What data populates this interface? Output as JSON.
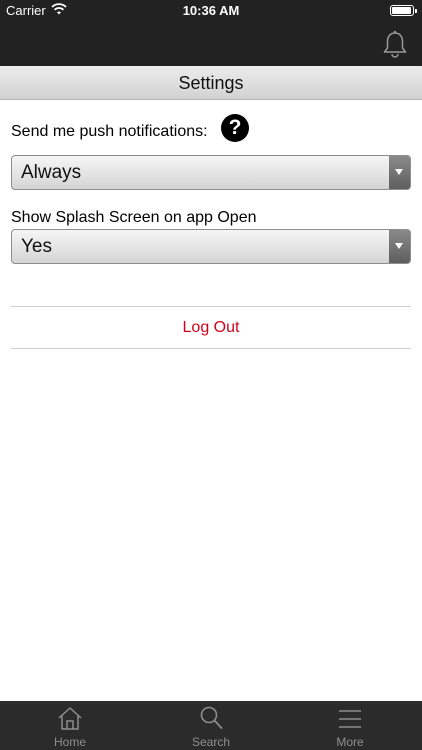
{
  "status_bar": {
    "carrier": "Carrier",
    "time": "10:36 AM",
    "battery_level": 0.95
  },
  "nav_bar": {
    "icon": "bell-icon"
  },
  "title": "Settings",
  "settings": {
    "push_label": "Send me push notifications:",
    "push_value": "Always",
    "help_icon": "question-circle-icon",
    "help_glyph": "?",
    "splash_label": "Show Splash Screen on app Open",
    "splash_value": "Yes"
  },
  "logout_label": "Log Out",
  "colors": {
    "bar_background": "#222222",
    "logout_text": "#d0021b",
    "tab_inactive": "#8e8e8e"
  },
  "tab_bar": [
    {
      "label": "Home",
      "icon": "home-icon"
    },
    {
      "label": "Search",
      "icon": "search-icon"
    },
    {
      "label": "More",
      "icon": "menu-icon"
    }
  ]
}
